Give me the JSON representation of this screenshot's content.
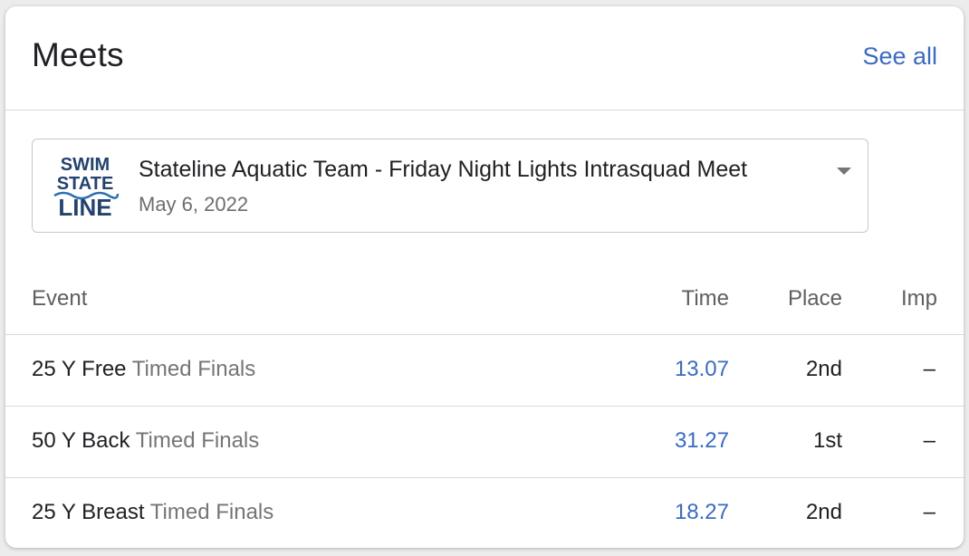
{
  "header": {
    "title": "Meets",
    "see_all": "See all"
  },
  "meet": {
    "name": "Stateline Aquatic Team - Friday Night Lights Intrasquad Meet",
    "date": "May 6, 2022",
    "logo": {
      "line1": "SWIM",
      "line2": "STATE",
      "line3": "LINE",
      "color": "#23426e"
    }
  },
  "table": {
    "headers": {
      "event": "Event",
      "time": "Time",
      "place": "Place",
      "imp": "Imp"
    },
    "rows": [
      {
        "event": "25 Y Free",
        "round": "Timed Finals",
        "time": "13.07",
        "place": "2nd",
        "imp": "–"
      },
      {
        "event": "50 Y Back",
        "round": "Timed Finals",
        "time": "31.27",
        "place": "1st",
        "imp": "–"
      },
      {
        "event": "25 Y Breast",
        "round": "Timed Finals",
        "time": "18.27",
        "place": "2nd",
        "imp": "–"
      }
    ]
  },
  "colors": {
    "link": "#3a6bbf",
    "text": "#202124",
    "muted": "#757575"
  }
}
